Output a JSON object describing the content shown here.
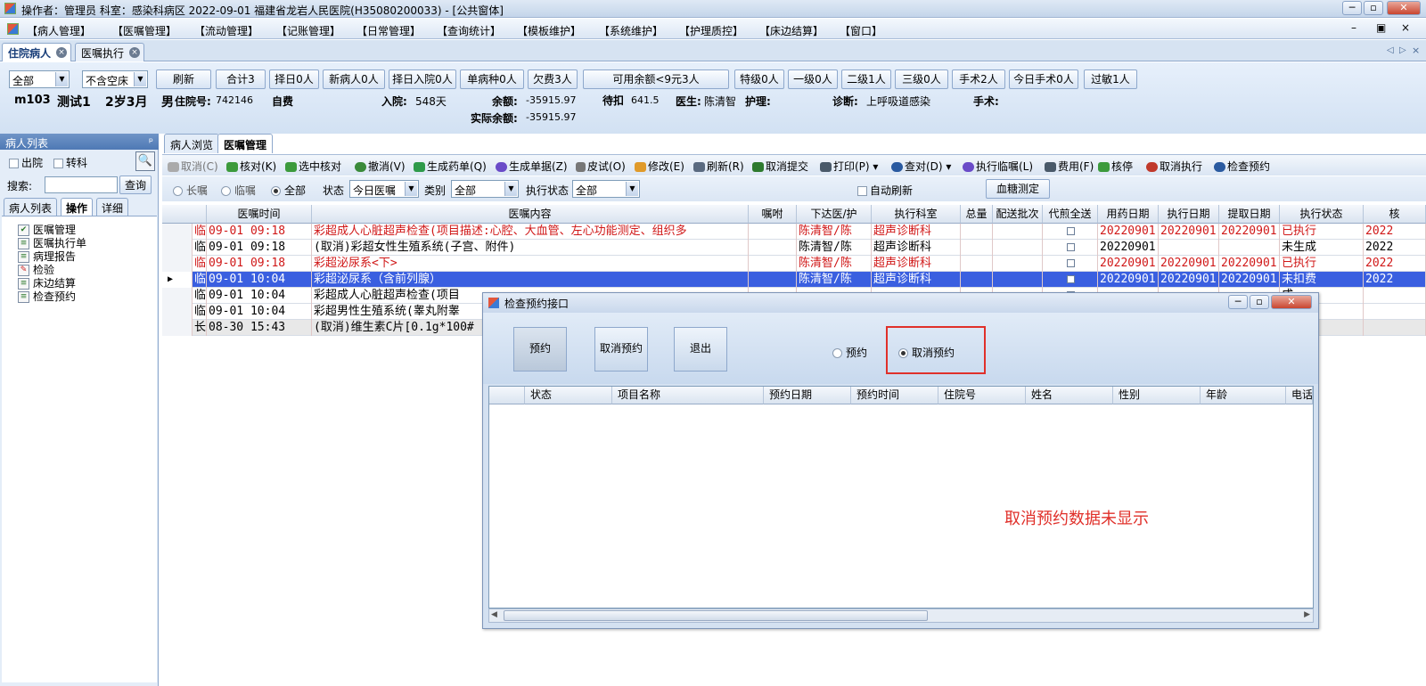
{
  "window": {
    "title": "操作者：管理员  科室：感染科病区  2022-09-01  福建省龙岩人民医院(H35080200033) - [公共窗体]"
  },
  "menu": [
    "【病人管理】",
    "【医嘱管理】",
    "【流动管理】",
    "【记账管理】",
    "【日常管理】",
    "【查询统计】",
    "【模板维护】",
    "【系统维护】",
    "【护理质控】",
    "【床边结算】",
    "【窗口】"
  ],
  "doc_tabs": [
    "住院病人",
    "医嘱执行"
  ],
  "filters": {
    "scope": "全部",
    "bed": "不含空床",
    "buttons": [
      "刷新",
      "合计3",
      "择日0人",
      "新病人0人",
      "择日入院0人",
      "单病种0人",
      "欠费3人",
      "可用余额<9元3人",
      "特级0人",
      "一级0人",
      "二级1人",
      "三级0人",
      "手术2人",
      "今日手术0人",
      "过敏1人"
    ]
  },
  "patient": {
    "bed": "m103",
    "name": "测试1",
    "age": "2岁3月",
    "sex": "男",
    "inpatient_no_label": "住院号:",
    "inpatient_no": "742146",
    "payment": "自费",
    "admission_label": "入院:",
    "admission_days": "548天",
    "balance_label": "余额:",
    "balance": "-35915.97",
    "pending_label": "待扣",
    "pending": "641.5",
    "actual_balance_label": "实际余额:",
    "actual_balance": "-35915.97",
    "doctor_label": "医生:",
    "doctor": "陈清智",
    "nurse_label": "护理:",
    "diagnosis_label": "诊断:",
    "diagnosis": "上呼吸道感染",
    "surgery_label": "手术:"
  },
  "left_panel": {
    "header": "病人列表",
    "pin": "ᵖ",
    "discharged": "出院",
    "transfer": "转科",
    "search_label": "搜索:",
    "search_button": "查询",
    "tabs": [
      "病人列表",
      "操作",
      "详细"
    ],
    "tree": [
      "医嘱管理",
      "医嘱执行单",
      "病理报告",
      "检验",
      "床边结算",
      "检查预约"
    ]
  },
  "sub_tabs": [
    "病人浏览",
    "医嘱管理"
  ],
  "toolbar": [
    "取消(C)",
    "核对(K)",
    "选中核对",
    "撤消(V)",
    "生成药单(Q)",
    "生成单据(Z)",
    "皮试(O)",
    "修改(E)",
    "刷新(R)",
    "取消提交",
    "打印(P)",
    "查对(D)",
    "执行临嘱(L)",
    "费用(F)",
    "核停",
    "取消执行",
    "检查预约"
  ],
  "options": {
    "long_term": "长嘱",
    "temporary": "临嘱",
    "all": "全部",
    "status_label": "状态",
    "status_value": "今日医嘱",
    "category_label": "类别",
    "category_value": "全部",
    "exec_status_label": "执行状态",
    "exec_status_value": "全部",
    "auto_refresh": "自动刷新",
    "glucose_button": "血糖测定"
  },
  "grid": {
    "columns": [
      "医嘱时间",
      "医嘱内容",
      "嘱咐",
      "下达医/护",
      "执行科室",
      "总量",
      "配送批次",
      "代煎全送",
      "用药日期",
      "执行日期",
      "提取日期",
      "执行状态",
      "核"
    ],
    "rows": [
      {
        "type": "临",
        "time": "09-01 09:18",
        "content": "彩超成人心脏超声检查(项目描述:心腔、大血管、左心功能测定、组织多",
        "doctor": "陈清智/陈",
        "dept": "超声诊断科",
        "use_date": "20220901",
        "exec_date": "20220901",
        "fetch_date": "20220901",
        "status": "已执行",
        "extra": "2022",
        "style": "red"
      },
      {
        "type": "临",
        "time": "09-01 09:18",
        "content": "(取消)彩超女性生殖系统(子宫、附件)",
        "doctor": "陈清智/陈",
        "dept": "超声诊断科",
        "use_date": "20220901",
        "exec_date": "",
        "fetch_date": "",
        "status": "未生成",
        "extra": "2022",
        "style": "normal"
      },
      {
        "type": "临",
        "time": "09-01 09:18",
        "content": "彩超泌尿系<下>",
        "doctor": "陈清智/陈",
        "dept": "超声诊断科",
        "use_date": "20220901",
        "exec_date": "20220901",
        "fetch_date": "20220901",
        "status": "已执行",
        "extra": "2022",
        "style": "red"
      },
      {
        "type": "临",
        "time": "09-01 10:04",
        "content": "彩超泌尿系（含前列腺）",
        "doctor": "陈清智/陈",
        "dept": "超声诊断科",
        "use_date": "20220901",
        "exec_date": "20220901",
        "fetch_date": "20220901",
        "status": "未扣费",
        "extra": "2022",
        "style": "sel"
      },
      {
        "type": "临",
        "time": "09-01 10:04",
        "content": "彩超成人心脏超声检查(项目",
        "doctor": "",
        "dept": "",
        "use_date": "",
        "exec_date": "",
        "fetch_date": "",
        "status": "成",
        "extra": "",
        "style": "normal"
      },
      {
        "type": "临",
        "time": "09-01 10:04",
        "content": "彩超男性生殖系统(睾丸附睾",
        "doctor": "",
        "dept": "",
        "use_date": "",
        "exec_date": "",
        "fetch_date": "",
        "status": "成",
        "extra": "",
        "style": "normal"
      },
      {
        "type": "长",
        "time": "08-30 15:43",
        "content": "(取消)维生素C片[0.1g*100#",
        "doctor": "",
        "dept": "",
        "use_date": "",
        "exec_date": "",
        "fetch_date": "",
        "status": "抽",
        "extra": "",
        "style": "gray"
      }
    ]
  },
  "dialog": {
    "title": "检查预约接口",
    "buttons": [
      "预约",
      "取消预约",
      "退出"
    ],
    "radio_book": "预约",
    "radio_cancel": "取消预约",
    "columns": [
      "状态",
      "项目名称",
      "预约日期",
      "预约时间",
      "住院号",
      "姓名",
      "性别",
      "年龄",
      "电话"
    ],
    "annotation": "取消预约数据未显示"
  },
  "colors": {
    "accent": "#3a5fe0",
    "annotation": "#e0302a",
    "alert_red": "#d01818"
  }
}
